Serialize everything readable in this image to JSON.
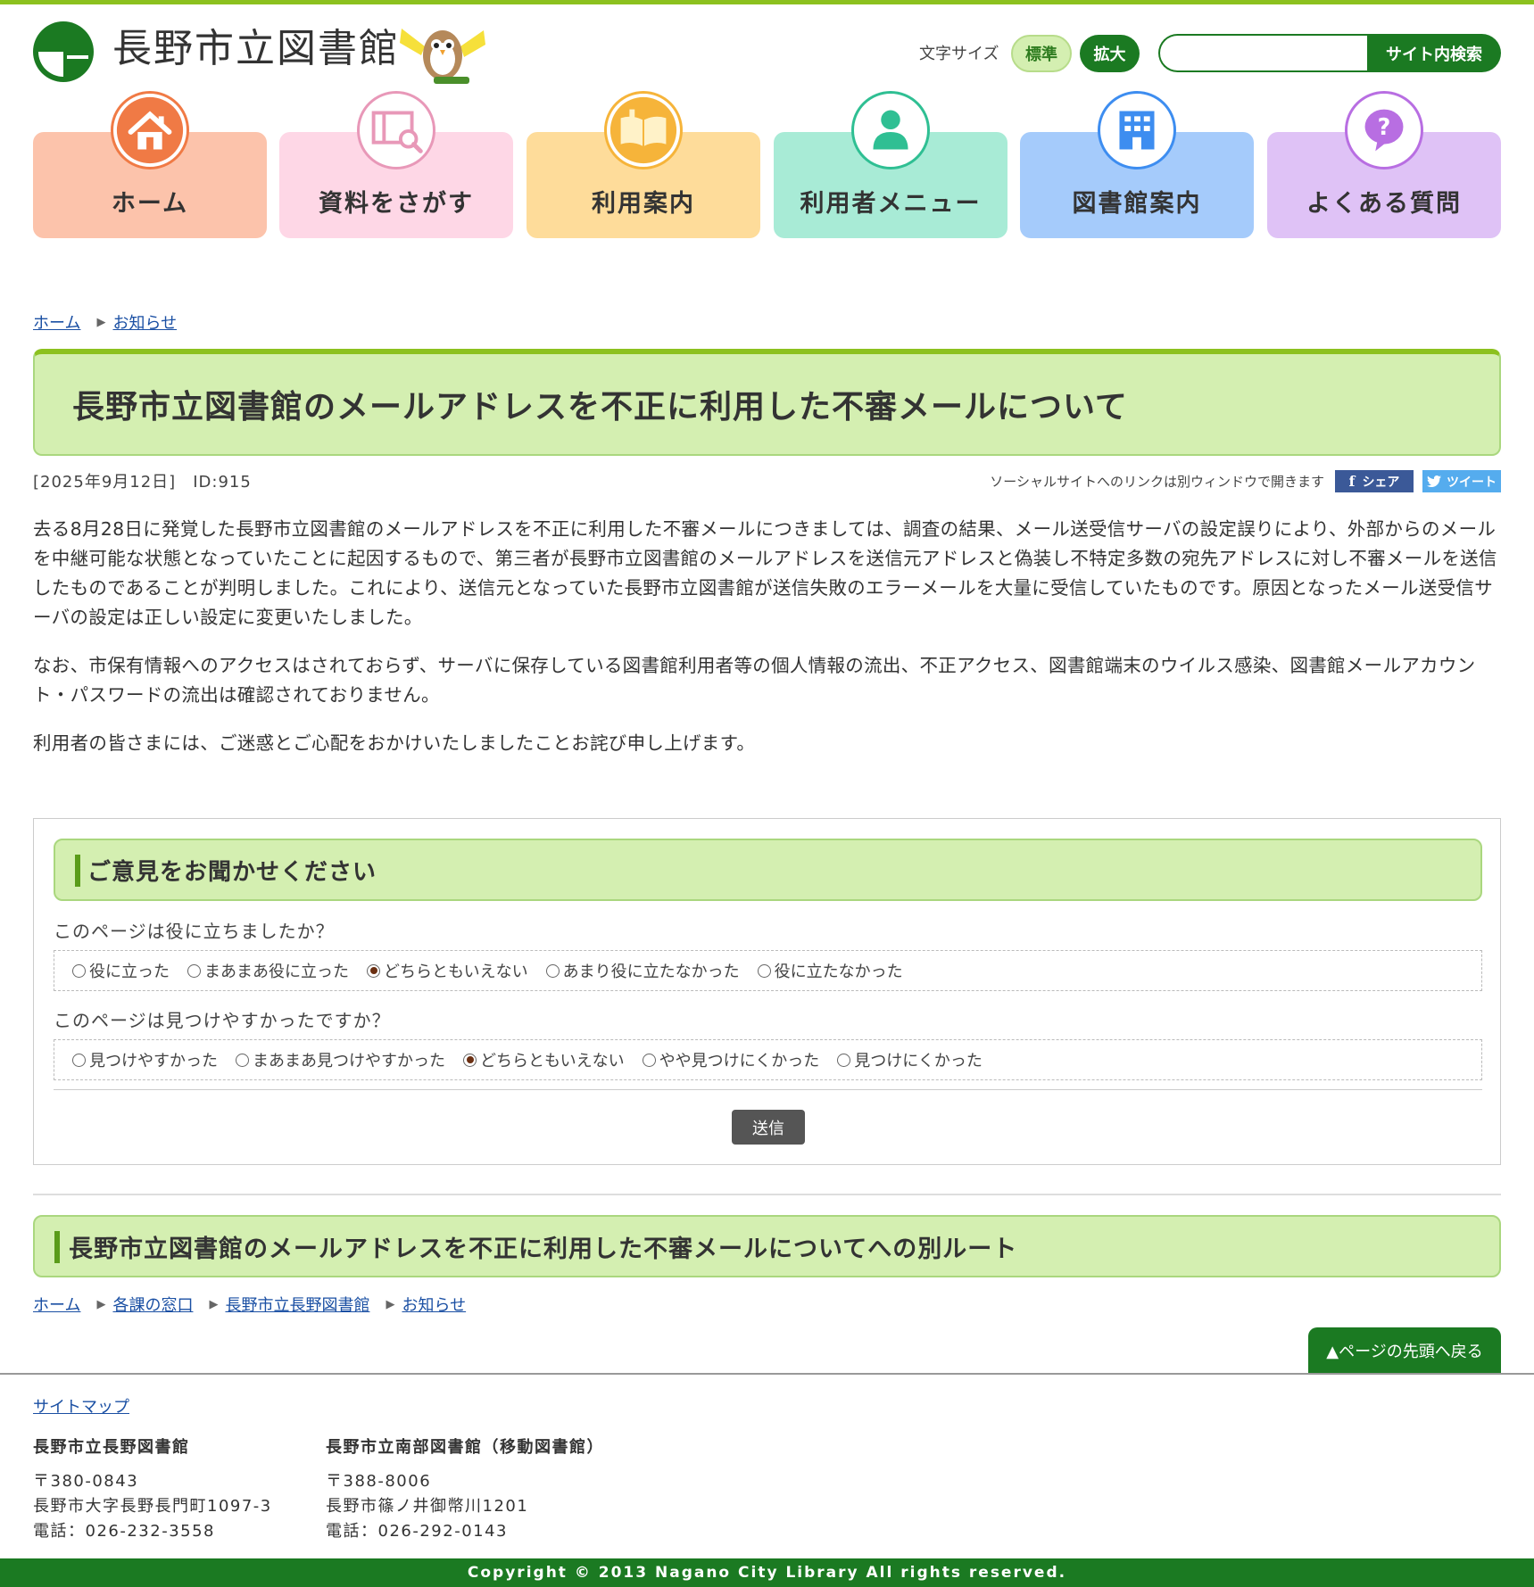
{
  "header": {
    "site_title": "長野市立図書館",
    "font_size_label": "文字サイズ",
    "font_size_standard": "標準",
    "font_size_large": "拡大",
    "search_placeholder": "",
    "search_button": "サイト内検索"
  },
  "nav": [
    {
      "label": "ホーム",
      "icon": "home-icon",
      "bg": "#fcc3ab",
      "icon_color": "#f07a45"
    },
    {
      "label": "資料をさがす",
      "icon": "book-search-icon",
      "bg": "#fed7e6",
      "icon_color": "#e898b8"
    },
    {
      "label": "利用案内",
      "icon": "open-book-icon",
      "bg": "#fedc9a",
      "icon_color": "#f6b43a"
    },
    {
      "label": "利用者メニュー",
      "icon": "user-icon",
      "bg": "#a8ebd6",
      "icon_color": "#2fbf93"
    },
    {
      "label": "図書館案内",
      "icon": "building-icon",
      "bg": "#a5cbfb",
      "icon_color": "#3d8df0"
    },
    {
      "label": "よくある質問",
      "icon": "question-icon",
      "bg": "#dfc2f6",
      "icon_color": "#b86ee2"
    }
  ],
  "breadcrumb": [
    "ホーム",
    "お知らせ"
  ],
  "article": {
    "title": "長野市立図書館のメールアドレスを不正に利用した不審メールについて",
    "meta": "[2025年9月12日]　ID:915",
    "social_note": "ソーシャルサイトへのリンクは別ウィンドウで開きます",
    "share_label": "シェア",
    "tweet_label": "ツイート",
    "paragraphs": [
      "去る8月28日に発覚した長野市立図書館のメールアドレスを不正に利用した不審メールにつきましては、調査の結果、メール送受信サーバの設定誤りにより、外部からのメールを中継可能な状態となっていたことに起因するもので、第三者が長野市立図書館のメールアドレスを送信元アドレスと偽装し不特定多数の宛先アドレスに対し不審メールを送信したものであることが判明しました。これにより、送信元となっていた長野市立図書館が送信失敗のエラーメールを大量に受信していたものです。原因となったメール送受信サーバの設定は正しい設定に変更いたしました。",
      "なお、市保有情報へのアクセスはされておらず、サーバに保存している図書館利用者等の個人情報の流出、不正アクセス、図書館端末のウイルス感染、図書館メールアカウント・パスワードの流出は確認されておりません。",
      "利用者の皆さまには、ご迷惑とご心配をおかけいたしましたことお詫び申し上げます。"
    ]
  },
  "feedback": {
    "heading": "ご意見をお聞かせください",
    "q1": "このページは役に立ちましたか？",
    "q1_options": [
      "役に立った",
      "まあまあ役に立った",
      "どちらともいえない",
      "あまり役に立たなかった",
      "役に立たなかった"
    ],
    "q1_selected": 2,
    "q2": "このページは見つけやすかったですか？",
    "q2_options": [
      "見つけやすかった",
      "まあまあ見つけやすかった",
      "どちらともいえない",
      "やや見つけにくかった",
      "見つけにくかった"
    ],
    "q2_selected": 2,
    "submit": "送信"
  },
  "route": {
    "heading": "長野市立図書館のメールアドレスを不正に利用した不審メールについてへの別ルート",
    "crumbs": [
      "ホーム",
      "各課の窓口",
      "長野市立長野図書館",
      "お知らせ"
    ]
  },
  "to_top": "▲ページの先頭へ戻る",
  "footer": {
    "sitemap": "サイトマップ",
    "libraries": [
      {
        "name": "長野市立長野図書館",
        "zip": "〒380-0843",
        "address": "長野市大字長野長門町1097-3",
        "tel": "電話：026-232-3558"
      },
      {
        "name": "長野市立南部図書館（移動図書館）",
        "zip": "〒388-8006",
        "address": "長野市篠ノ井御幣川1201",
        "tel": "電話：026-292-0143"
      }
    ],
    "copyright": "Copyright © 2013 Nagano City Library All rights reserved."
  },
  "colors": {
    "brand_green": "#1b7a22",
    "accent_green": "#8cc11f",
    "panel_green": "#d4efb1"
  }
}
